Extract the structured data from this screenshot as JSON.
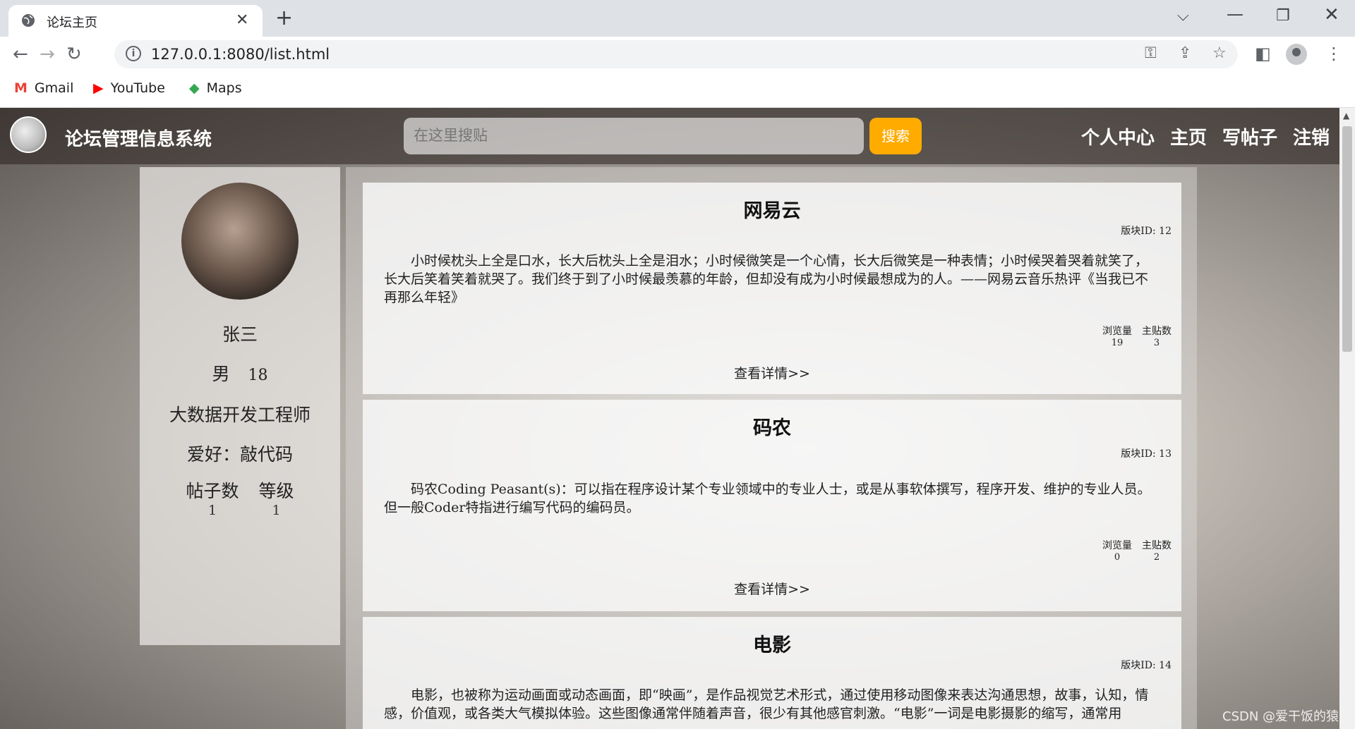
{
  "browser": {
    "tab_title": "论坛主页",
    "url": "127.0.0.1:8080/list.html",
    "bookmarks": [
      {
        "label": "Gmail",
        "icon": "gmail-icon",
        "color": "#ea4335"
      },
      {
        "label": "YouTube",
        "icon": "youtube-icon",
        "color": "#ff0000"
      },
      {
        "label": "Maps",
        "icon": "maps-icon",
        "color": "#34a853"
      }
    ]
  },
  "site": {
    "title": "论坛管理信息系统",
    "search_placeholder": "在这里搜贴",
    "search_button": "搜索",
    "nav": [
      "个人中心",
      "主页",
      "写帖子",
      "注销"
    ]
  },
  "profile": {
    "name": "张三",
    "gender": "男",
    "age": "18",
    "job": "大数据开发工程师",
    "hobby": "爱好：敲代码",
    "stats": [
      {
        "label": "帖子数",
        "value": "1"
      },
      {
        "label": "等级",
        "value": "1"
      }
    ]
  },
  "posts": [
    {
      "title": "网易云",
      "board_id": "版块ID: 12",
      "content": "小时候枕头上全是口水，长大后枕头上全是泪水；小时候微笑是一个心情，长大后微笑是一种表情；小时候哭着哭着就笑了，长大后笑着笑着就哭了。我们终于到了小时候最羡慕的年龄，但却没有成为小时候最想成为的人。——网易云音乐热评《当我已不再那么年轻》",
      "views_label": "浏览量",
      "views": "19",
      "replies_label": "主贴数",
      "replies": "3",
      "more": "查看详情>>"
    },
    {
      "title": "码农",
      "board_id": "版块ID: 13",
      "content": "码农Coding Peasant(s)：可以指在程序设计某个专业领域中的专业人士，或是从事软体撰写，程序开发、维护的专业人员。但一般Coder特指进行编写代码的编码员。",
      "views_label": "浏览量",
      "views": "0",
      "replies_label": "主贴数",
      "replies": "2",
      "more": "查看详情>>"
    },
    {
      "title": "电影",
      "board_id": "版块ID: 14",
      "content": "电影，也被称为运动画面或动态画面，即“映画”，是作品视觉艺术形式，通过使用移动图像来表达沟通思想，故事，认知，情感，价值观，或各类大气模拟体验。这些图像通常伴随着声音，很少有其他感官刺激。“电影”一词是电影摄影的缩写，通常用"
    }
  ],
  "watermark": "CSDN @爱干饭的猿"
}
